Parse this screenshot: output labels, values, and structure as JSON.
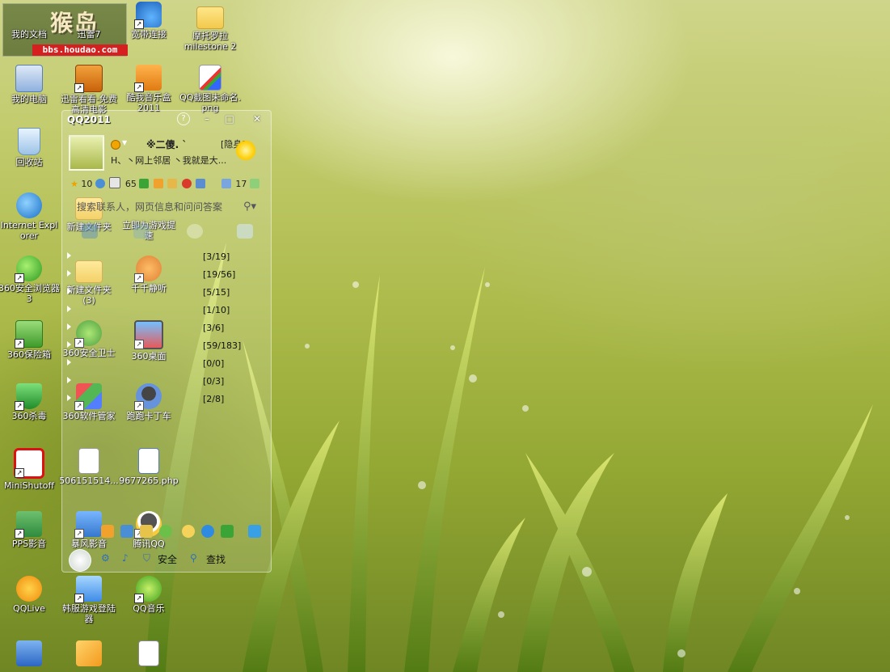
{
  "watermark": {
    "brand_cn": "猴岛",
    "url": "bbs.houdao.com"
  },
  "desktop_icons": [
    {
      "key": "my-documents",
      "label": "我的文档",
      "shortcut": false
    },
    {
      "key": "xunlei7",
      "label": "迅雷7",
      "shortcut": true
    },
    {
      "key": "broadband",
      "label": "宽带连接",
      "shortcut": true
    },
    {
      "key": "moto-folder",
      "label": "摩托罗拉",
      "label2": "milestone 2",
      "shortcut": false
    },
    {
      "key": "my-computer",
      "label": "我的电脑",
      "shortcut": false
    },
    {
      "key": "xunlei-kankan",
      "label": "迅雷看看-免费高清电影",
      "shortcut": true
    },
    {
      "key": "kuwo-box",
      "label": "酷我音乐盒",
      "label2": "2011",
      "shortcut": true
    },
    {
      "key": "qq-screenshot",
      "label": "QQ截图未命名.png",
      "shortcut": false
    },
    {
      "key": "recycle-bin",
      "label": "回收站",
      "shortcut": false
    },
    {
      "key": "ie",
      "label": "Internet Explorer",
      "shortcut": false
    },
    {
      "key": "new-folder",
      "label": "新建文件夹",
      "shortcut": false
    },
    {
      "key": "game-accel",
      "label": "立即为游戏提速",
      "shortcut": true
    },
    {
      "key": "360-browser",
      "label": "360安全浏览器 3",
      "shortcut": true
    },
    {
      "key": "new-folder-3",
      "label": "新建文件夹",
      "label2": "(3)",
      "shortcut": false
    },
    {
      "key": "ttplayer",
      "label": "千千静听",
      "shortcut": true
    },
    {
      "key": "360-safebox",
      "label": "360保险箱",
      "shortcut": true
    },
    {
      "key": "360-guard",
      "label": "360安全卫士",
      "shortcut": true
    },
    {
      "key": "360-desktop",
      "label": "360桌面",
      "shortcut": true
    },
    {
      "key": "360-antivirus",
      "label": "360杀毒",
      "shortcut": true
    },
    {
      "key": "360-softmgr",
      "label": "360软件管家",
      "shortcut": true
    },
    {
      "key": "kart",
      "label": "跑跑卡丁车",
      "shortcut": true
    },
    {
      "key": "minishutoff",
      "label": "MiniShutoff",
      "shortcut": true
    },
    {
      "key": "file-506",
      "label": "506151514...",
      "shortcut": false
    },
    {
      "key": "file-php",
      "label": "9677265.php",
      "shortcut": false
    },
    {
      "key": "pps",
      "label": "PPS影音",
      "shortcut": true
    },
    {
      "key": "storm",
      "label": "暴风影音",
      "shortcut": true
    },
    {
      "key": "tencent-qq",
      "label": "腾讯QQ",
      "shortcut": true
    },
    {
      "key": "qqlive",
      "label": "QQLive",
      "shortcut": false
    },
    {
      "key": "game-login",
      "label": "韩服游戏登陆器",
      "shortcut": true
    },
    {
      "key": "qqmusic",
      "label": "QQ音乐",
      "shortcut": true
    }
  ],
  "qq_panel": {
    "title_overlay": "QQ2011",
    "help": "?",
    "minimize": "–",
    "maximize": "□",
    "close": "✕",
    "nickname": "※二傻.    `",
    "status_label": "[隐身]",
    "signature": "H、丶网上邻居 丶我就是大...",
    "stats": {
      "qzone": "10",
      "mail": "65",
      "messages": "17"
    },
    "search_placeholder": "搜索联系人，网页信息和问问答案",
    "groups": [
      {
        "count": "[3/19]"
      },
      {
        "count": "[19/56]"
      },
      {
        "count": "[5/15]"
      },
      {
        "count": "[1/10]"
      },
      {
        "count": "[3/6]"
      },
      {
        "count": "[59/183]"
      },
      {
        "count": "[0/0]"
      },
      {
        "count": "[0/3]"
      },
      {
        "count": "[2/8]"
      }
    ],
    "tools": {
      "safety": "安全",
      "find": "查找"
    }
  }
}
